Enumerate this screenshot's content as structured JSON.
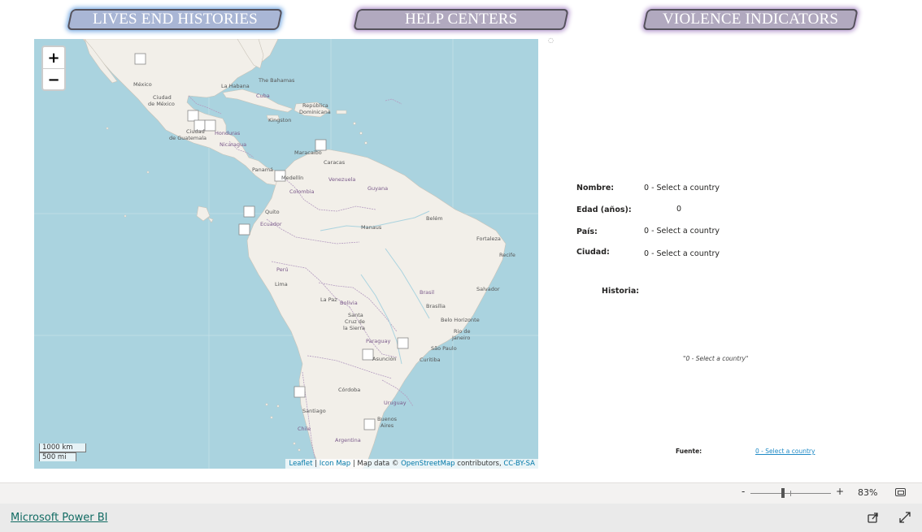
{
  "nav": {
    "lives_end_histories": "LIVES END HISTORIES",
    "help_centers": "HELP CENTERS",
    "violence_indicators": "VIOLENCE INDICATORS"
  },
  "map": {
    "zoom_in": "+",
    "zoom_out": "−",
    "scale_km": "1000 km",
    "scale_mi": "500 mi",
    "attribution": {
      "leaflet": "Leaflet",
      "sep1": " | ",
      "icon_map": "Icon Map",
      "map_data": " | Map data © ",
      "osm": "OpenStreetMap",
      "contributors": " contributors, ",
      "license": "CC-BY-SA"
    },
    "labels": {
      "mexico": "México",
      "ciudad_mexico_1": "Ciudad",
      "ciudad_mexico_2": "de México",
      "la_habana": "La Habana",
      "bahamas": "The Bahamas",
      "cuba": "Cuba",
      "republica": "República",
      "dominicana": "Dominicana",
      "kingston": "Kingston",
      "ciudad_guatemala_1": "Ciudad",
      "ciudad_guatemala_2": "de Guatemala",
      "honduras": "Honduras",
      "nicaragua": "Nicaragua",
      "panama": "Panamá",
      "maracaibo": "Maracaibo",
      "caracas": "Caracas",
      "medellin": "Medellín",
      "venezuela": "Venezuela",
      "guyana": "Guyana",
      "colombia": "Colombia",
      "quito": "Quito",
      "ecuador": "Ecuador",
      "manaus": "Manaus",
      "belem": "Belém",
      "fortaleza": "Fortaleza",
      "recife": "Recife",
      "peru": "Perú",
      "lima": "Lima",
      "brasil": "Brasil",
      "brasilia": "Brasília",
      "salvador": "Salvador",
      "la_paz": "La Paz",
      "bolivia": "Bolivia",
      "santa_cruz_1": "Santa",
      "santa_cruz_2": "Cruz de",
      "santa_cruz_3": "la Sierra",
      "belo_horizonte": "Belo Horizonte",
      "rio_1": "Rio de",
      "rio_2": "Janeiro",
      "paraguay": "Paraguay",
      "asuncion": "Asunción",
      "sao_paulo": "São Paulo",
      "curitiba": "Curitiba",
      "cordoba": "Córdoba",
      "uruguay": "Uruguay",
      "santiago": "Santiago",
      "buenos_aires_1": "Buenos",
      "buenos_aires_2": "Aires",
      "chile": "Chile",
      "argentina": "Argentina"
    }
  },
  "detail": {
    "nombre_label": "Nombre:",
    "nombre_value": "0 - Select a country",
    "edad_label": "Edad (años):",
    "edad_value": "0",
    "pais_label": "País:",
    "pais_value": "0 - Select a country",
    "ciudad_label": "Ciudad:",
    "ciudad_value": "0 - Select a country",
    "historia_label": "Historia:",
    "historia_text": "\"0 - Select a country\"",
    "fuente_label": "Fuente:",
    "fuente_link": "0 - Select a country"
  },
  "powerbi": {
    "zoom_minus": "-",
    "zoom_plus": "+",
    "zoom_percent": "83%",
    "zoom_level": 0.4,
    "footer_link": "Microsoft Power BI"
  },
  "colors": {
    "water": "#aad3df",
    "land": "#f2efe9",
    "border": "#b49cc0",
    "link": "#0078a8",
    "pbi_link": "#116b63"
  }
}
